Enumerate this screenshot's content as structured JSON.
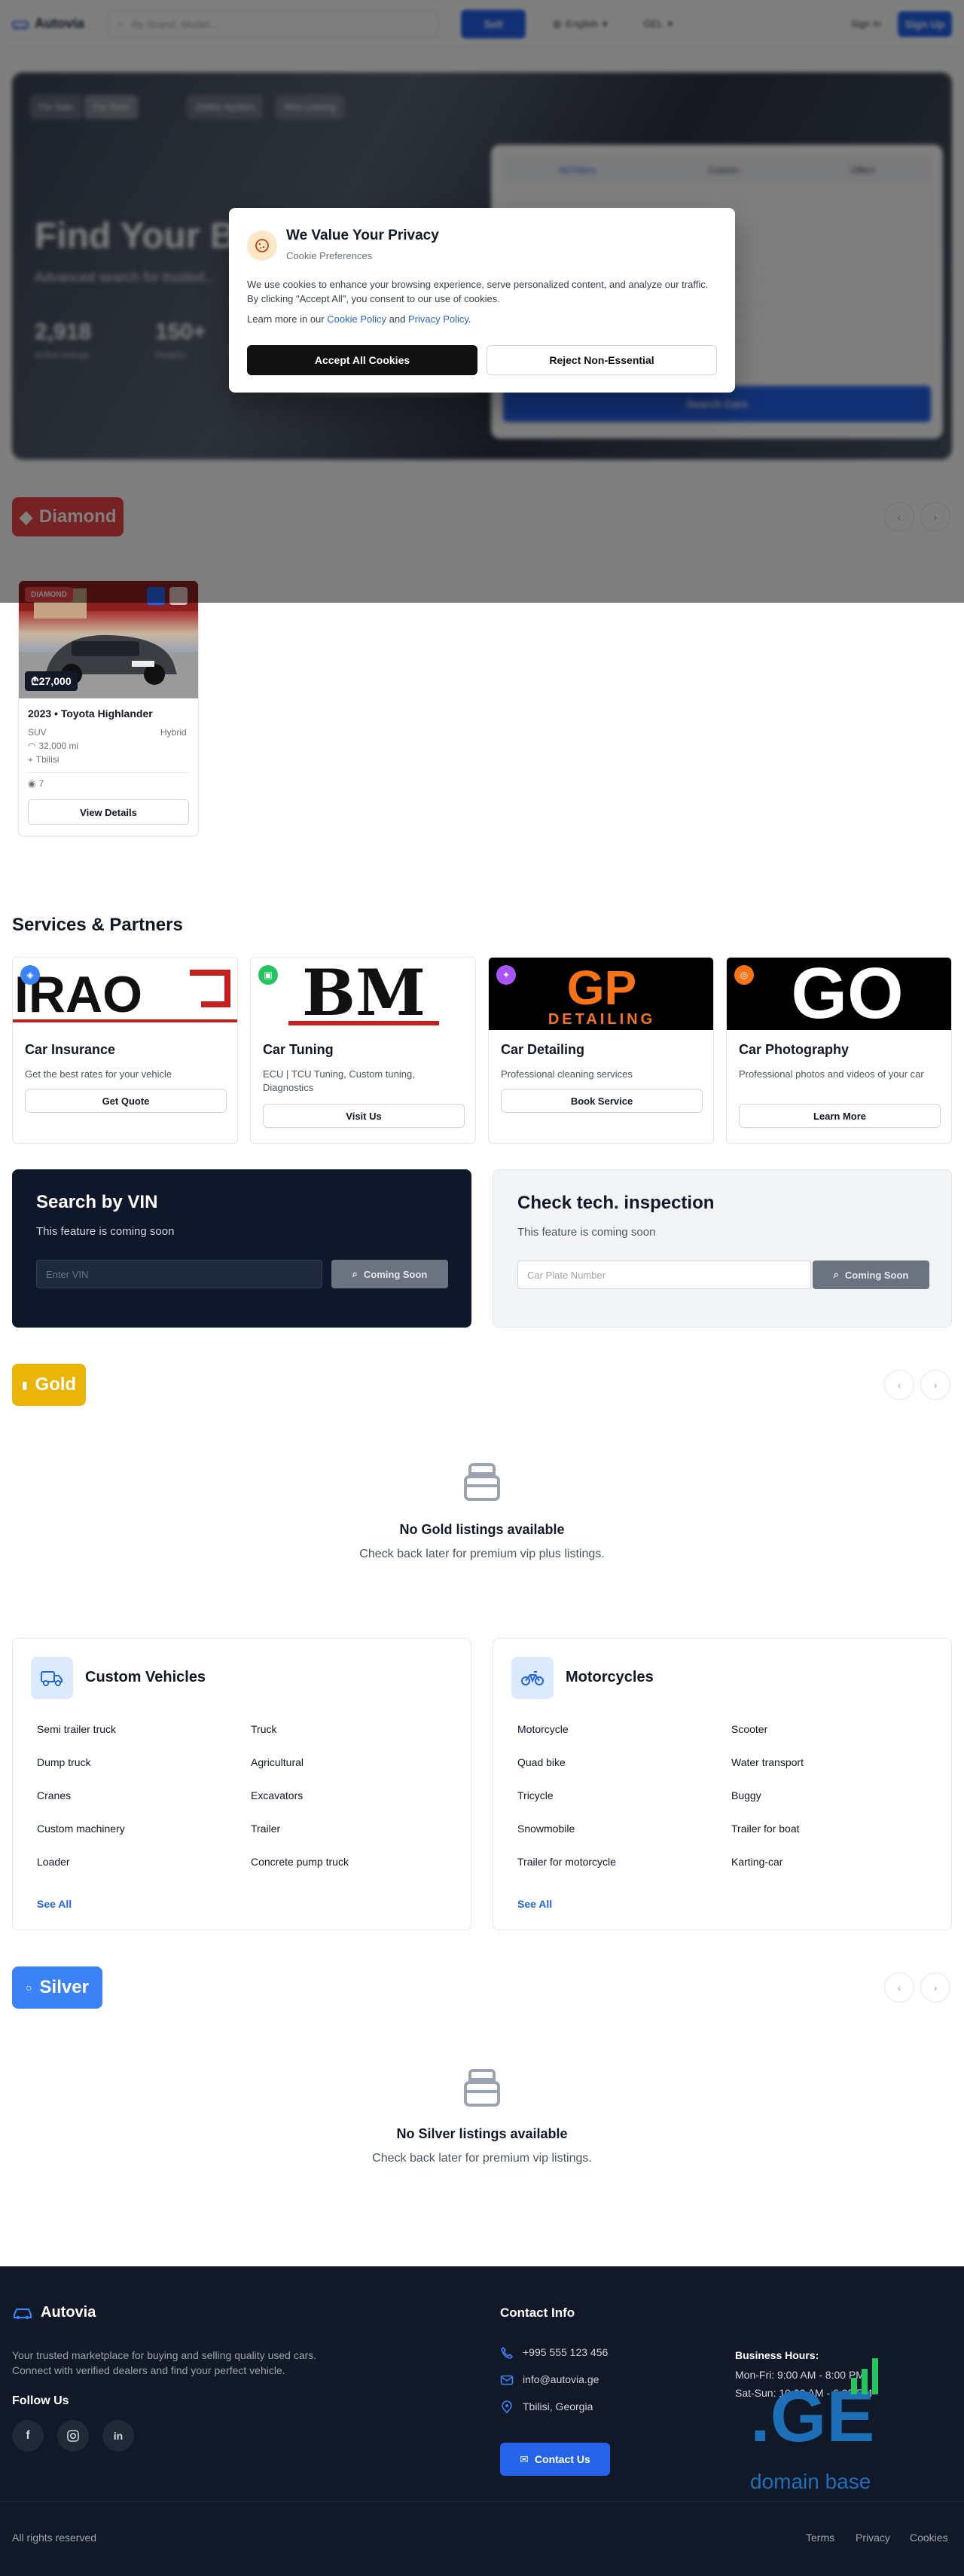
{
  "header": {
    "logo": "Autovia",
    "search_placeholder": "By Brand, Model...",
    "search_button": "Sell",
    "language": "English",
    "currency": "GEL",
    "sign_in": "Sign In",
    "sign_up": "Sign Up"
  },
  "hero": {
    "chips": [
      "For Sale",
      "For Rent",
      "Online Auction",
      "Mini Leasing"
    ],
    "title": "Find Your Be",
    "subtitle": "Advanced search for trusted...",
    "stats": [
      {
        "value": "2,918",
        "label": "Active listings"
      },
      {
        "value": "150+",
        "label": "Dealers"
      }
    ],
    "form_tabs": [
      "All Filters",
      "Custom",
      "Offers"
    ],
    "search_button": "Search Cars"
  },
  "cookie": {
    "title": "We Value Your Privacy",
    "subtitle": "Cookie Preferences",
    "text": "We use cookies to enhance your browsing experience, serve personalized content, and analyze our traffic. By clicking \"Accept All\", you consent to our use of cookies.",
    "learn_prefix": "Learn more in our",
    "cookie_policy": "Cookie Policy",
    "and": "and",
    "privacy_policy": "Privacy Policy",
    "privacy_suffix": ".",
    "accept": "Accept All Cookies",
    "reject": "Reject Non-Essential"
  },
  "diamond": {
    "label": "Diamond"
  },
  "listing": {
    "badge": "DIAMOND",
    "price": "₾27,000",
    "title": "2023 • Toyota Highlander",
    "body": "SUV",
    "fuel": "Hybrid",
    "mileage": "32,000 mi",
    "location": "Tbilisi",
    "views": "7",
    "button": "View Details"
  },
  "services": {
    "title": "Services & Partners",
    "items": [
      {
        "logo": "IRAO",
        "name": "Car Insurance",
        "desc": "Get the best rates for your vehicle",
        "button": "Get Quote",
        "color": "#3b82f6"
      },
      {
        "logo": "BM",
        "name": "Car Tuning",
        "desc": "ECU | TCU Tuning, Custom tuning, Diagnostics",
        "button": "Visit Us",
        "color": "#22c55e"
      },
      {
        "logo": "GP",
        "logo_sub": "DETAILING",
        "name": "Car Detailing",
        "desc": "Professional cleaning services",
        "button": "Book Service",
        "color": "#a855f7"
      },
      {
        "logo": "GO",
        "name": "Car Photography",
        "desc": "Professional photos and videos of your car",
        "button": "Learn More",
        "color": "#f97316"
      }
    ]
  },
  "vin": {
    "title": "Search by VIN",
    "sub": "This feature is coming soon",
    "placeholder": "Enter VIN",
    "button": "Coming Soon"
  },
  "inspection": {
    "title": "Check tech. inspection",
    "sub": "This feature is coming soon",
    "placeholder": "Car Plate Number",
    "button": "Coming Soon"
  },
  "gold": {
    "label": "Gold",
    "empty_title": "No Gold listings available",
    "empty_sub": "Check back later for premium vip plus listings."
  },
  "custom_vehicles": {
    "title": "Custom Vehicles",
    "items": [
      "Semi trailer truck",
      "Truck",
      "Dump truck",
      "Agricultural",
      "Cranes",
      "Excavators",
      "Custom machinery",
      "Trailer",
      "Loader",
      "Concrete pump truck"
    ],
    "see_all": "See All"
  },
  "motorcycles": {
    "title": "Motorcycles",
    "items": [
      "Motorcycle",
      "Scooter",
      "Quad bike",
      "Water transport",
      "Tricycle",
      "Buggy",
      "Snowmobile",
      "Trailer for boat",
      "Trailer for motorcycle",
      "Karting-car"
    ],
    "see_all": "See All"
  },
  "silver": {
    "label": "Silver",
    "empty_title": "No Silver listings available",
    "empty_sub": "Check back later for premium vip listings."
  },
  "footer": {
    "brand": "Autovia",
    "desc1": "Your trusted marketplace for buying and selling quality used cars.",
    "desc2": "Connect with verified dealers and find your perfect vehicle.",
    "follow": "Follow Us",
    "contact_title": "Contact Info",
    "phone": "+995 555 123 456",
    "email": "info@autovia.ge",
    "address": "Tbilisi, Georgia",
    "contact_button": "Contact Us",
    "hours_title": "Business Hours:",
    "hours1": "Mon-Fri: 9:00 AM - 8:00 PM",
    "hours2": "Sat-Sun: 10:00 AM - 6:00 PM",
    "domain_ge": ".GE",
    "domain_base": "domain base",
    "rights": "All rights reserved",
    "terms": "Terms",
    "privacy": "Privacy",
    "cookies": "Cookies"
  }
}
